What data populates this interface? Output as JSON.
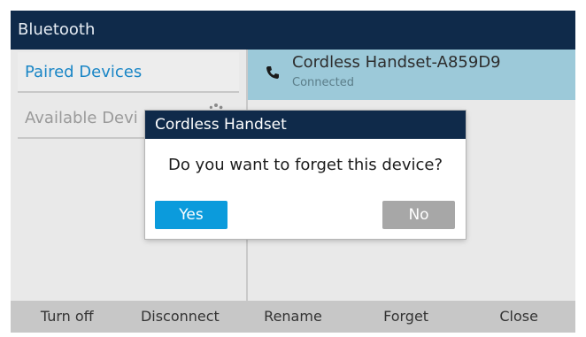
{
  "titlebar": {
    "title": "Bluetooth"
  },
  "sidebar": {
    "items": [
      {
        "label": "Paired Devices"
      },
      {
        "label": "Available Devi"
      }
    ]
  },
  "device": {
    "name": "Cordless Handset-A859D9",
    "status": "Connected"
  },
  "dialog": {
    "title": "Cordless Handset",
    "message": "Do you want to forget this device?",
    "yes_label": "Yes",
    "no_label": "No"
  },
  "softkeys": [
    "Turn off",
    "Disconnect",
    "Rename",
    "Forget",
    "Close"
  ],
  "icons": {
    "phone": "phone-icon",
    "spinner": "loading-spinner-icon"
  },
  "colors": {
    "titlebar": "#0f2a4a",
    "accent": "#0b9bdc",
    "selected_row": "#9cc9d9"
  }
}
